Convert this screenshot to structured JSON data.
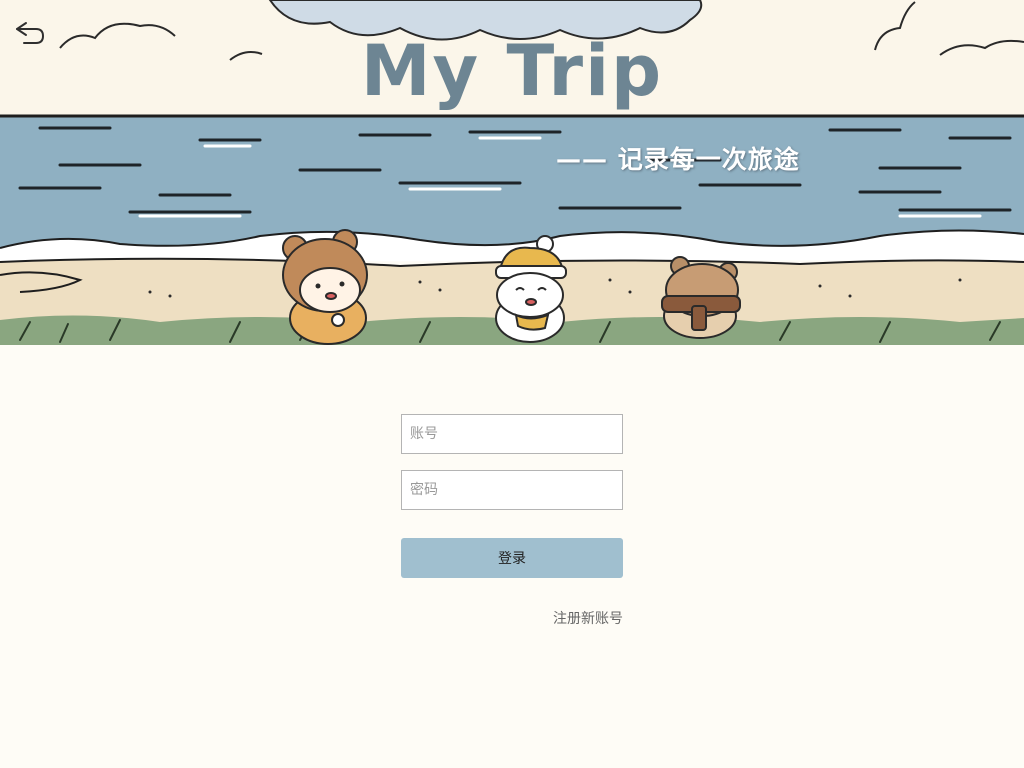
{
  "header": {
    "title": "My Trip",
    "subtitle": "—— 记录每一次旅途",
    "back_icon": "back-arrow-icon"
  },
  "login": {
    "account_placeholder": "账号",
    "password_placeholder": "密码",
    "login_label": "登录",
    "register_label": "注册新账号"
  },
  "colors": {
    "background": "#fefcf6",
    "title": "#6d8593",
    "sea": "#8fb0c2",
    "button": "#a0bfcf"
  }
}
